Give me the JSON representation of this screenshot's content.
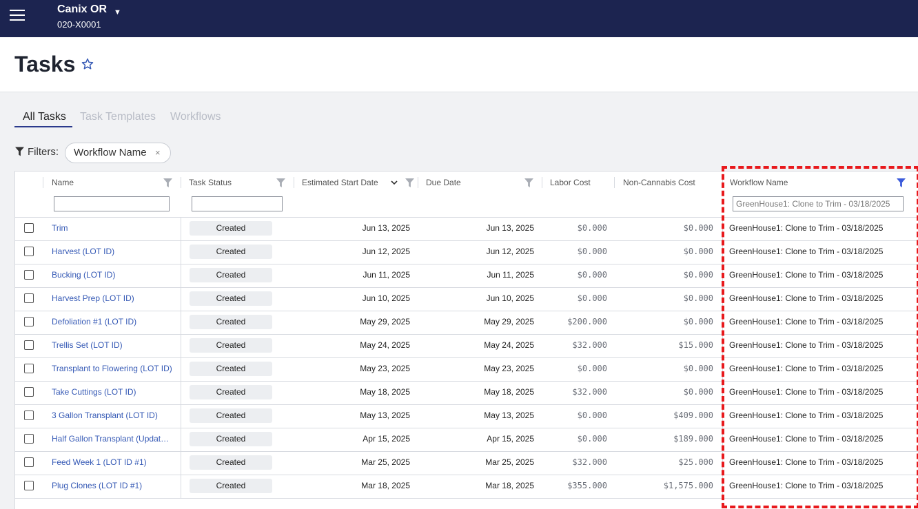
{
  "topbar": {
    "org_name": "Canix OR",
    "org_id": "020-X0001"
  },
  "page": {
    "title": "Tasks"
  },
  "tabs": [
    "All Tasks",
    "Task Templates",
    "Workflows"
  ],
  "filters": {
    "label": "Filters:",
    "chip": "Workflow Name",
    "chip_remove": "×"
  },
  "columns": {
    "name": "Name",
    "task_status": "Task Status",
    "est_start": "Estimated Start Date",
    "due_date": "Due Date",
    "labor_cost": "Labor Cost",
    "non_cannabis_cost": "Non-Cannabis Cost",
    "workflow_name": "Workflow Name"
  },
  "workflow_filter_value": "GreenHouse1: Clone to Trim - 03/18/2025",
  "rows": [
    {
      "name": "Trim",
      "status": "Created",
      "start": "Jun 13, 2025",
      "due": "Jun 13, 2025",
      "labor": "$0.000",
      "noncan": "$0.000",
      "workflow": "GreenHouse1: Clone to Trim - 03/18/2025"
    },
    {
      "name": "Harvest (LOT ID)",
      "status": "Created",
      "start": "Jun 12, 2025",
      "due": "Jun 12, 2025",
      "labor": "$0.000",
      "noncan": "$0.000",
      "workflow": "GreenHouse1: Clone to Trim - 03/18/2025"
    },
    {
      "name": "Bucking (LOT ID)",
      "status": "Created",
      "start": "Jun 11, 2025",
      "due": "Jun 11, 2025",
      "labor": "$0.000",
      "noncan": "$0.000",
      "workflow": "GreenHouse1: Clone to Trim - 03/18/2025"
    },
    {
      "name": "Harvest Prep (LOT ID)",
      "status": "Created",
      "start": "Jun 10, 2025",
      "due": "Jun 10, 2025",
      "labor": "$0.000",
      "noncan": "$0.000",
      "workflow": "GreenHouse1: Clone to Trim - 03/18/2025"
    },
    {
      "name": "Defoliation #1 (LOT ID)",
      "status": "Created",
      "start": "May 29, 2025",
      "due": "May 29, 2025",
      "labor": "$200.000",
      "noncan": "$0.000",
      "workflow": "GreenHouse1: Clone to Trim - 03/18/2025"
    },
    {
      "name": "Trellis Set (LOT ID)",
      "status": "Created",
      "start": "May 24, 2025",
      "due": "May 24, 2025",
      "labor": "$32.000",
      "noncan": "$15.000",
      "workflow": "GreenHouse1: Clone to Trim - 03/18/2025"
    },
    {
      "name": "Transplant to Flowering (LOT ID)",
      "status": "Created",
      "start": "May 23, 2025",
      "due": "May 23, 2025",
      "labor": "$0.000",
      "noncan": "$0.000",
      "workflow": "GreenHouse1: Clone to Trim - 03/18/2025"
    },
    {
      "name": "Take Cuttings (LOT ID)",
      "status": "Created",
      "start": "May 18, 2025",
      "due": "May 18, 2025",
      "labor": "$32.000",
      "noncan": "$0.000",
      "workflow": "GreenHouse1: Clone to Trim - 03/18/2025"
    },
    {
      "name": "3 Gallon Transplant (LOT ID)",
      "status": "Created",
      "start": "May 13, 2025",
      "due": "May 13, 2025",
      "labor": "$0.000",
      "noncan": "$409.000",
      "workflow": "GreenHouse1: Clone to Trim - 03/18/2025"
    },
    {
      "name": "Half Gallon Transplant (Update ...",
      "status": "Created",
      "start": "Apr 15, 2025",
      "due": "Apr 15, 2025",
      "labor": "$0.000",
      "noncan": "$189.000",
      "workflow": "GreenHouse1: Clone to Trim - 03/18/2025"
    },
    {
      "name": "Feed Week 1 (LOT ID #1)",
      "status": "Created",
      "start": "Mar 25, 2025",
      "due": "Mar 25, 2025",
      "labor": "$32.000",
      "noncan": "$25.000",
      "workflow": "GreenHouse1: Clone to Trim - 03/18/2025"
    },
    {
      "name": "Plug Clones (LOT ID #1)",
      "status": "Created",
      "start": "Mar 18, 2025",
      "due": "Mar 18, 2025",
      "labor": "$355.000",
      "noncan": "$1,575.000",
      "workflow": "GreenHouse1: Clone to Trim - 03/18/2025"
    }
  ],
  "colors": {
    "topbar": "#1c2450",
    "link": "#3559b5",
    "highlight": "#e8191c",
    "active_filter": "#3b5bdb"
  }
}
